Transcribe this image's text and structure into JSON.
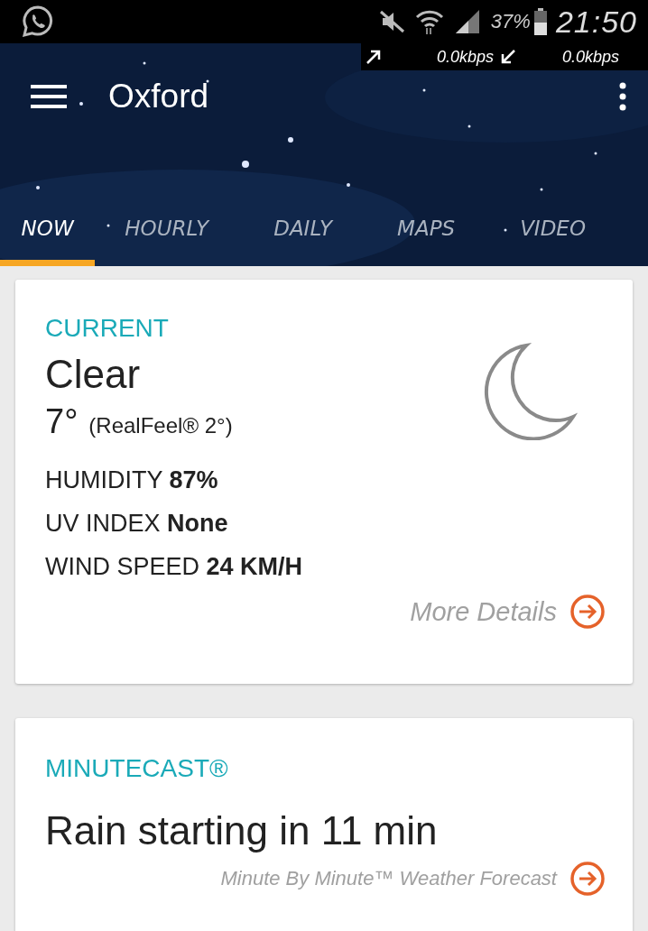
{
  "status_bar": {
    "battery": "37%",
    "time": "21:50"
  },
  "net_speed": {
    "upload": "0.0kbps",
    "download": "0.0kbps"
  },
  "app_bar": {
    "title": "Oxford"
  },
  "tabs": [
    {
      "label": "NOW",
      "selected": true
    },
    {
      "label": "HOURLY",
      "selected": false
    },
    {
      "label": "DAILY",
      "selected": false
    },
    {
      "label": "MAPS",
      "selected": false
    },
    {
      "label": "VIDEO",
      "selected": false
    }
  ],
  "current": {
    "heading": "CURRENT",
    "condition": "Clear",
    "temperature": "7°",
    "realfeel": "(RealFeel® 2°)",
    "stats": [
      {
        "label": "HUMIDITY",
        "value": "87%"
      },
      {
        "label": "UV INDEX",
        "value": "None"
      },
      {
        "label": "WIND SPEED",
        "value": "24 KM/H"
      }
    ],
    "link": "More Details"
  },
  "minutecast": {
    "heading": "MINUTECAST®",
    "summary": "Rain starting in 11 min",
    "link": "Minute By Minute™ Weather Forecast"
  }
}
